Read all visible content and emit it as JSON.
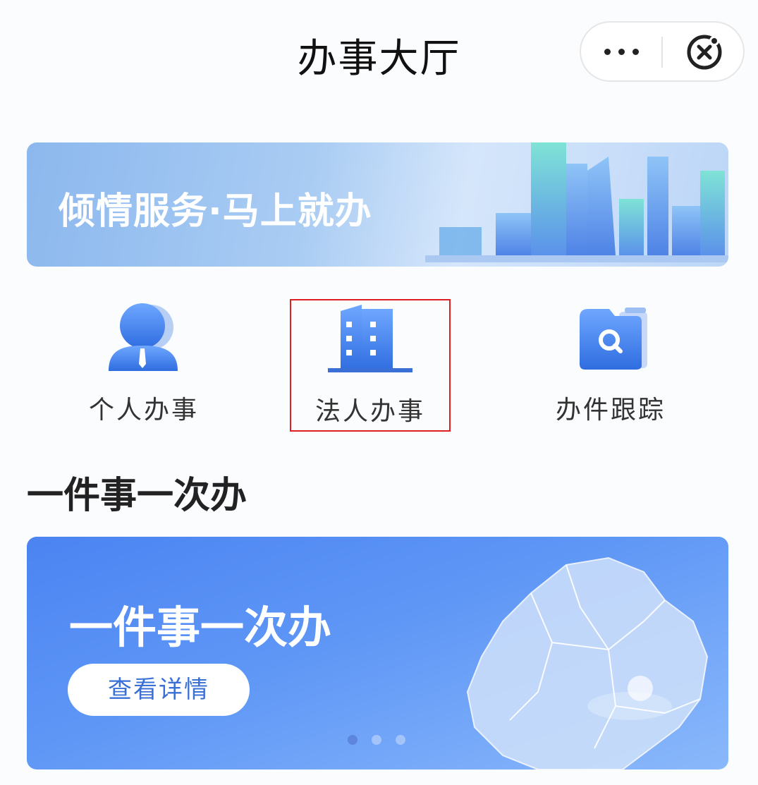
{
  "header": {
    "title": "办事大厅",
    "more_icon": "more-dots-icon",
    "close_icon": "close-circle-icon"
  },
  "banner": {
    "slogan": "倾情服务·马上就办"
  },
  "quick_actions": [
    {
      "label": "个人办事",
      "icon": "person-icon",
      "selected": false
    },
    {
      "label": "法人办事",
      "icon": "building-icon",
      "selected": true
    },
    {
      "label": "办件跟踪",
      "icon": "folder-search-icon",
      "selected": false
    }
  ],
  "section": {
    "title": "一件事一次办"
  },
  "promo_card": {
    "title": "一件事一次办",
    "button_label": "查看详情",
    "page_count": 3,
    "active_page": 1
  },
  "colors": {
    "accent_blue": "#3a6fd6",
    "selection_border": "#e02020"
  }
}
